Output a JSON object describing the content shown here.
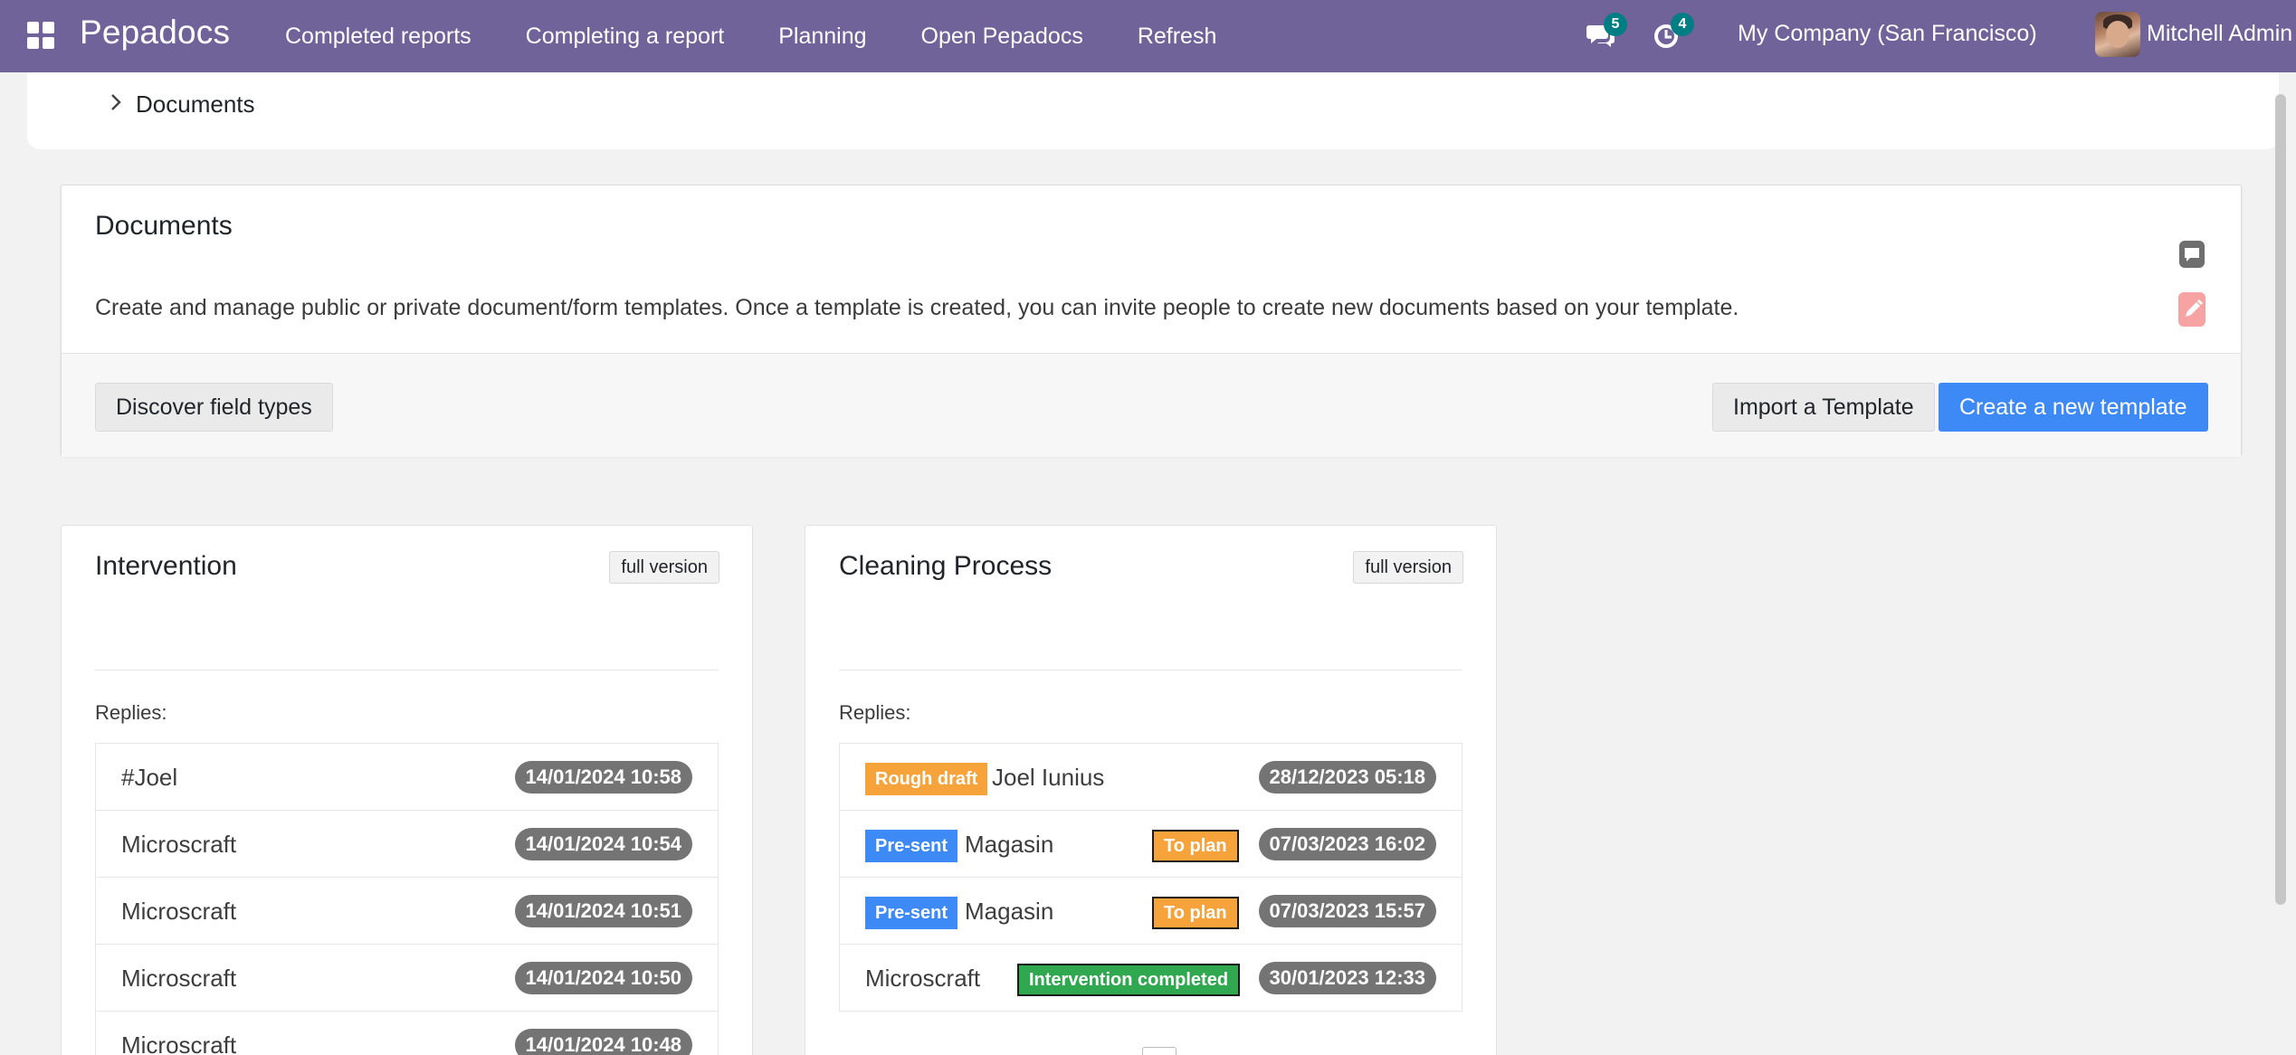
{
  "navbar": {
    "brand": "Pepadocs",
    "menu": [
      {
        "label": "Completed reports"
      },
      {
        "label": "Completing a report"
      },
      {
        "label": "Planning"
      },
      {
        "label": "Open Pepadocs"
      },
      {
        "label": "Refresh"
      }
    ],
    "messages_count": "5",
    "activities_count": "4",
    "company": "My Company (San Francisco)",
    "user": "Mitchell Admin",
    "accent_color": "#6f6399",
    "badge_color": "#017e84"
  },
  "breadcrumb": {
    "label": "Documents"
  },
  "documents_panel": {
    "title": "Documents",
    "description": "Create and manage public or private document/form templates. Once a template is created, you can invite people to create new documents based on your template.",
    "discover_button": "Discover field types",
    "import_button": "Import a Template",
    "create_button": "Create a new template",
    "primary_color": "#3d8af7"
  },
  "templates": [
    {
      "title": "Intervention",
      "version": "full version",
      "replies_label": "Replies:",
      "replies": [
        {
          "name": "#Joel",
          "date": "14/01/2024 10:58"
        },
        {
          "name": "Microscraft",
          "date": "14/01/2024 10:54"
        },
        {
          "name": "Microscraft",
          "date": "14/01/2024 10:51"
        },
        {
          "name": "Microscraft",
          "date": "14/01/2024 10:50"
        },
        {
          "name": "Microscraft",
          "date": "14/01/2024 10:48"
        }
      ]
    },
    {
      "title": "Cleaning Process",
      "version": "full version",
      "replies_label": "Replies:",
      "replies": [
        {
          "tag": "Rough draft",
          "name": "Joel Iunius",
          "date": "28/12/2023 05:18"
        },
        {
          "tag": "Pre-sent",
          "name": "Magasin",
          "status": "To plan",
          "date": "07/03/2023 16:02"
        },
        {
          "tag": "Pre-sent",
          "name": "Magasin",
          "status": "To plan",
          "date": "07/03/2023 15:57"
        },
        {
          "name": "Microscraft",
          "status": "Intervention completed",
          "date": "30/01/2023 12:33"
        }
      ]
    }
  ]
}
